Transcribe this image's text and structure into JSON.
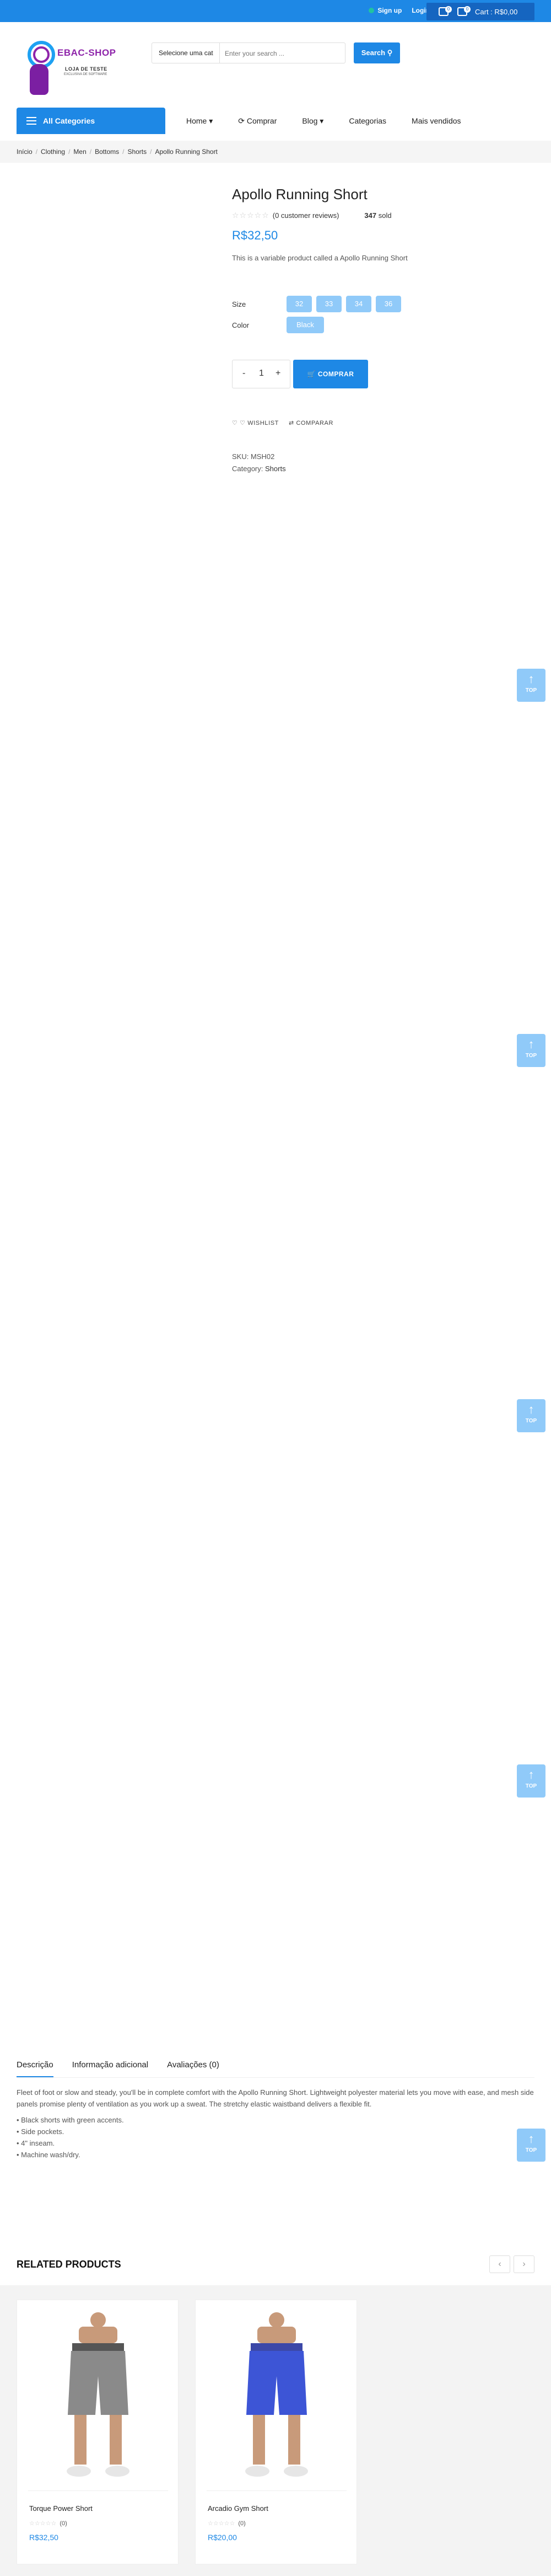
{
  "topbar": {
    "signup": "Sign up",
    "login": "Login",
    "wishlist_count": "0",
    "cart_count": "0",
    "cart_label": "Cart : R$0,00"
  },
  "header": {
    "logo_text": "EBAC-SHOP",
    "logo_sub": "LOJA DE TESTE",
    "logo_sub2": "EXCLUSIVA DE SOFTWARE",
    "search_category": "Selecione uma cat",
    "search_placeholder": "Enter your search ...",
    "search_button": "Search"
  },
  "nav": {
    "all_categories": "All Categories",
    "items": [
      "Home",
      "Comprar",
      "Blog",
      "Categorias",
      "Mais vendidos"
    ]
  },
  "breadcrumb": [
    "Início",
    "Clothing",
    "Men",
    "Bottoms",
    "Shorts",
    "Apollo Running Short"
  ],
  "product": {
    "title": "Apollo Running Short",
    "stars": "☆☆☆☆☆",
    "reviews": "(0 customer reviews)",
    "sold_count": "347",
    "sold_label": "sold",
    "price": "R$32,50",
    "short_description": "This is a variable product called a Apollo Running Short",
    "size_label": "Size",
    "sizes": [
      "32",
      "33",
      "34",
      "36"
    ],
    "color_label": "Color",
    "colors": [
      "Black"
    ],
    "qty_minus": "-",
    "qty_value": "1",
    "qty_plus": "+",
    "buy_button": "COMPRAR",
    "wishlist": "WISHLIST",
    "compare": "COMPARAR",
    "sku_label": "SKU:",
    "sku": "MSH02",
    "category_label": "Category:",
    "category": "Shorts"
  },
  "back_to_top": "TOP",
  "tabs": [
    "Descrição",
    "Informação adicional",
    "Avaliações (0)"
  ],
  "description": {
    "paragraph": "Fleet of foot or slow and steady, you'll be in complete comfort with the Apollo Running Short. Lightweight polyester material lets you move with ease, and mesh side panels promise plenty of ventilation as you work up a sweat. The stretchy elastic waistband delivers a flexible fit.",
    "bullets": [
      "• Black shorts with green accents.",
      "• Side pockets.",
      "• 4\" inseam.",
      "• Machine wash/dry."
    ]
  },
  "related": {
    "title": "RELATED PRODUCTS",
    "prev": "‹",
    "next": "›",
    "products": [
      {
        "name": "Torque Power Short",
        "stars": "☆☆☆☆☆",
        "count": "(0)",
        "price": "R$32,50",
        "color": "#8a8a8a"
      },
      {
        "name": "Arcadio Gym Short",
        "stars": "☆☆☆☆☆",
        "count": "(0)",
        "price": "R$20,00",
        "color": "#3d55d6"
      }
    ]
  }
}
